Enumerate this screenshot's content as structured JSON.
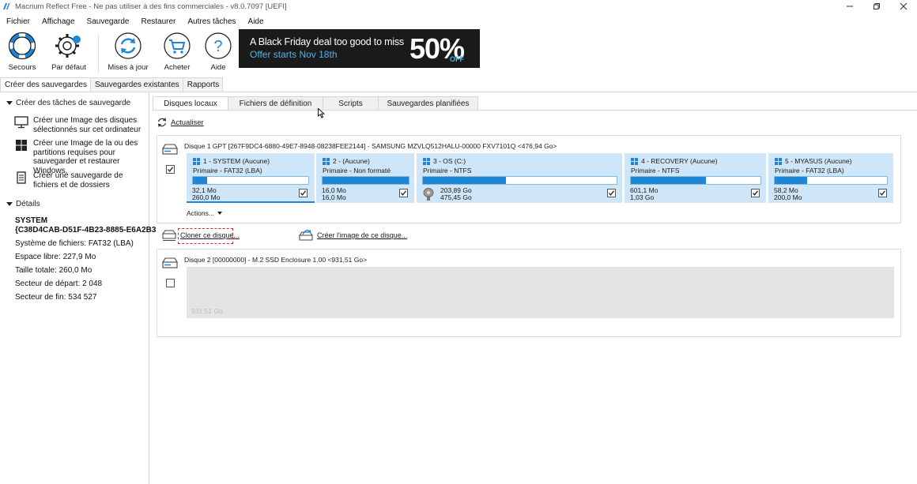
{
  "window": {
    "title": "Macrium Reflect Free - Ne pas utiliser à des fins commerciales - v8.0.7097  [UEFI]"
  },
  "menu": [
    "Fichier",
    "Affichage",
    "Sauvegarde",
    "Restaurer",
    "Autres tâches",
    "Aide"
  ],
  "toolbar": {
    "buttons": [
      {
        "label": "Secours",
        "icon": "lifebuoy-icon"
      },
      {
        "label": "Par défaut",
        "icon": "gear-icon"
      },
      {
        "label": "Mises à jour",
        "icon": "refresh-icon"
      },
      {
        "label": "Acheter",
        "icon": "cart-icon"
      },
      {
        "label": "Aide",
        "icon": "help-icon"
      }
    ],
    "banner": {
      "line1": "A Black Friday deal too good to miss",
      "line2": "Offer starts Nov 18th",
      "percent": "50%",
      "off": "OFF"
    }
  },
  "top_tabs": [
    "Créer des sauvegardes",
    "Sauvegardes existantes",
    "Rapports"
  ],
  "left": {
    "tasks_header": "Créer des tâches de sauvegarde",
    "tasks": [
      {
        "label": "Créer une Image des disques sélectionnés sur cet ordinateur",
        "icon": "monitor-icon"
      },
      {
        "label": "Créer une Image de la ou des partitions requises pour sauvegarder et restaurer Windows.",
        "icon": "windows-icon"
      },
      {
        "label": "Créer une sauvegarde de fichiers et de dossiers",
        "icon": "document-icon"
      }
    ],
    "details_header": "Détails",
    "details": {
      "name_line1": "SYSTEM",
      "name_line2": "{C38D4CAB-D51F-4B23-8885-E6A2B3",
      "fs": "Système de fichiers: FAT32 (LBA)",
      "free": "Espace libre:    227,9 Mo",
      "total": "Taille totale:     260,0 Mo",
      "start": "Secteur de départ:     2 048",
      "end": "Secteur de fin:     534 527"
    }
  },
  "right_tabs": [
    "Disques locaux",
    "Fichiers de définition",
    "Scripts",
    "Sauvegardes planifiées"
  ],
  "refresh_label": "Actualiser",
  "disk1": {
    "title": "Disque 1 GPT [267F9DC4-6880-49E7-8948-08238FEE2144] - SAMSUNG MZVLQ512HALU-00000 FXV7101Q  <476,94 Go>",
    "partitions": [
      {
        "header": "1 - SYSTEM (Aucune)",
        "type": "Primaire - FAT32 (LBA)",
        "used": "32,1 Mo",
        "total": "260,0 Mo",
        "fill": 0.12
      },
      {
        "header": "2 -  (Aucune)",
        "type": "Primaire - Non formaté",
        "used": "16,0 Mo",
        "total": "16,0 Mo",
        "fill": 1.0
      },
      {
        "header": "3 - OS (C:)",
        "type": "Primaire - NTFS",
        "used": "203,89 Go",
        "total": "475,45 Go",
        "fill": 0.43
      },
      {
        "header": "4 - RECOVERY (Aucune)",
        "type": "Primaire - NTFS",
        "used": "601,1 Mo",
        "total": "1,03 Go",
        "fill": 0.58
      },
      {
        "header": "5 - MYASUS (Aucune)",
        "type": "Primaire - FAT32 (LBA)",
        "used": "58,2 Mo",
        "total": "200,0 Mo",
        "fill": 0.29
      }
    ],
    "actions_label": "Actions..."
  },
  "ops": {
    "clone": "Cloner ce disque...",
    "image": "Créer l'image de ce disque..."
  },
  "disk2": {
    "title": "Disque 2 [00000000] - M.2 SSD  Enclosure          1.00   <931,51 Go>",
    "unallocated": "931,51 Go"
  },
  "colors": {
    "partition_bg": "#cfe6f8",
    "usage_fill": "#1f86d6",
    "highlight": "#e0282b"
  }
}
